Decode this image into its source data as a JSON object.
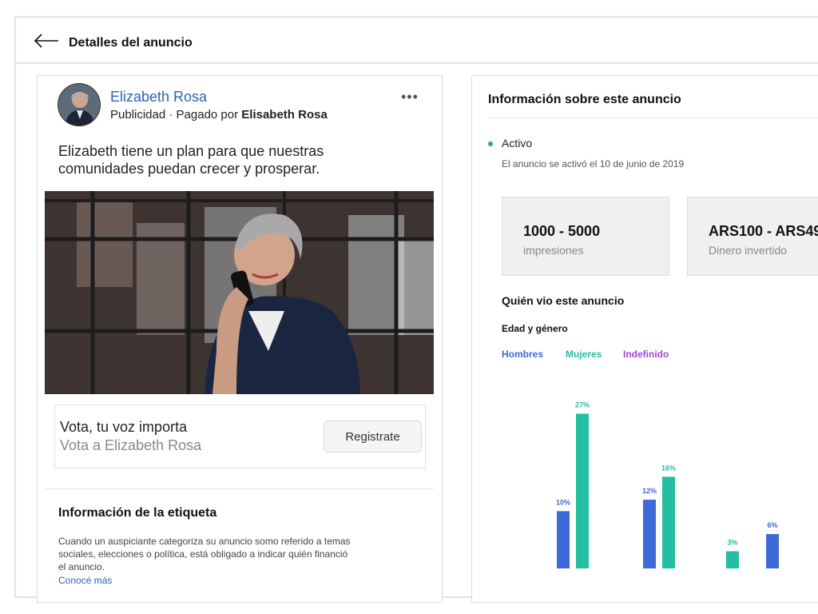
{
  "header": {
    "title": "Detalles del anuncio",
    "back_icon": "arrow-left-icon"
  },
  "post": {
    "author": "Elizabeth Rosa",
    "sponsor_prefix": "Publicidad · Pagado por ",
    "sponsor_name": "Elisabeth Rosa",
    "more_icon": "more-horizontal-icon",
    "text_line1": "Elizabeth tiene un plan para que nuestras",
    "text_line2": "comunidades puedan crecer y prosperar.",
    "image_alt": "woman-on-phone-photo",
    "cta_title": "Vota, tu voz importa",
    "cta_subtitle": "Vota a Elizabeth Rosa",
    "cta_button": "Registrate"
  },
  "label_info": {
    "title": "Información de la etiqueta",
    "text_line1": "Cuando un auspiciante categoriza su anuncio somo referido a temas",
    "text_line2": "sociales, elecciones o política, está obligado a indicar quién financió",
    "text_line3": "el anuncio.",
    "learn_more": "Conocé más"
  },
  "info": {
    "title": "Información sobre este anuncio",
    "status": "Activo",
    "status_color": "#27b24f",
    "activated": "El anuncio se activó el 10 de junio de 2019",
    "stats": [
      {
        "value": "1000 - 5000",
        "label": "impresiones"
      },
      {
        "value": "ARS100 - ARS49",
        "label": "Dinero invertido"
      }
    ],
    "who_title": "Quién vio este anuncio",
    "age_gender": "Edad y género",
    "legend": [
      {
        "label": "Hombres",
        "color": "#3d6ad6"
      },
      {
        "label": "Mujeres",
        "color": "#23bfa0"
      },
      {
        "label": "Indefinido",
        "color": "#a246d6"
      }
    ]
  },
  "chart_data": {
    "type": "bar",
    "title": "",
    "xlabel": "",
    "ylabel": "",
    "ylim": [
      0,
      30
    ],
    "series": [
      {
        "name": "Hombres",
        "color": "#3d6ad6",
        "values": [
          10,
          12,
          null,
          6
        ]
      },
      {
        "name": "Mujeres",
        "color": "#23bfa0",
        "values": [
          27,
          16,
          3,
          null
        ]
      }
    ],
    "value_labels": {
      "Hombres": [
        "10%",
        "12%",
        null,
        "6%"
      ],
      "Mujeres": [
        "27%",
        "16%",
        "3%",
        null
      ]
    }
  }
}
